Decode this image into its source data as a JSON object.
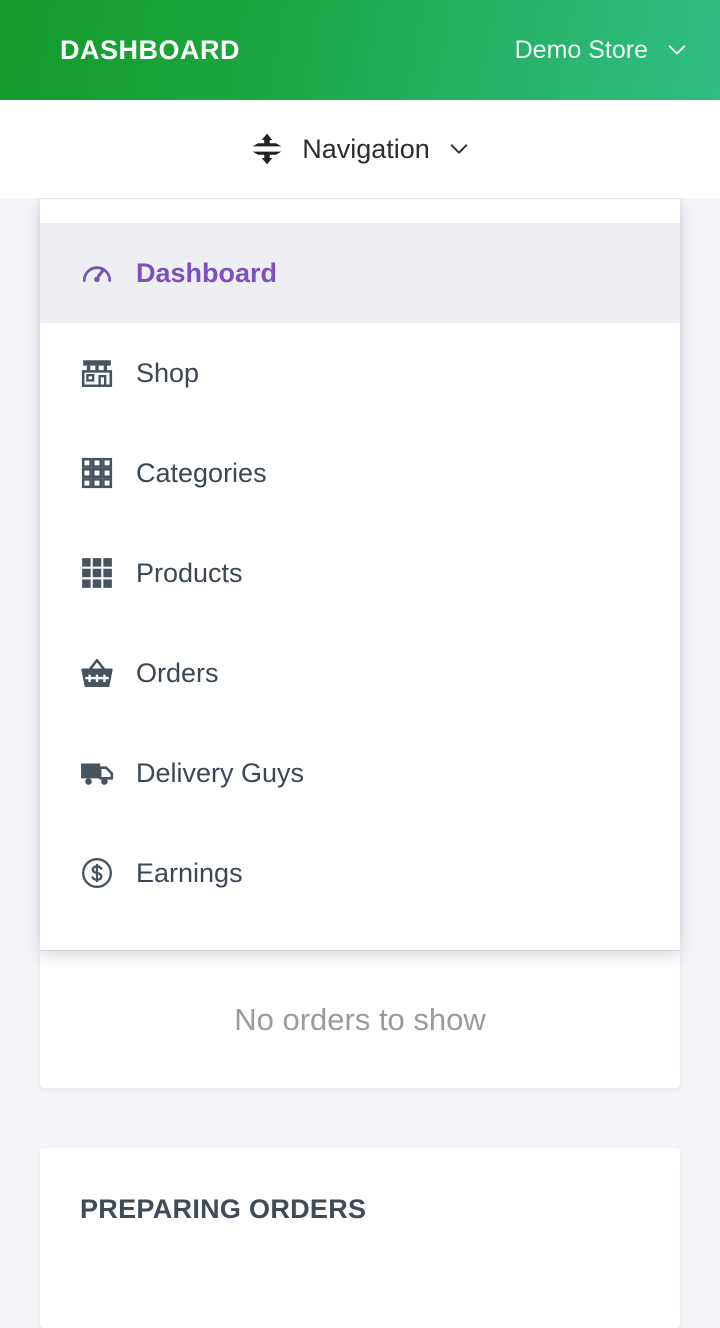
{
  "header": {
    "title": "DASHBOARD",
    "store_name": "Demo Store",
    "store_caret_icon": "chevron-down-icon",
    "gradient_from": "#159a2b",
    "gradient_to": "#2fbd84"
  },
  "nav_bar": {
    "expand_icon": "arrows-expand-vertical-icon",
    "label": "Navigation",
    "caret_icon": "chevron-down-icon"
  },
  "nav_dropdown": {
    "active_color": "#7e4fc0",
    "items": [
      {
        "label": "Dashboard",
        "icon": "tachometer-icon",
        "active": true
      },
      {
        "label": "Shop",
        "icon": "store-icon",
        "active": false
      },
      {
        "label": "Categories",
        "icon": "grid-outline-icon",
        "active": false
      },
      {
        "label": "Products",
        "icon": "grid-filled-icon",
        "active": false
      },
      {
        "label": "Orders",
        "icon": "basket-icon",
        "active": false
      },
      {
        "label": "Delivery Guys",
        "icon": "truck-icon",
        "active": false
      },
      {
        "label": "Earnings",
        "icon": "dollar-circle-icon",
        "active": false
      }
    ]
  },
  "main": {
    "empty_orders_text": "No orders to show",
    "preparing_orders_title": "PREPARING ORDERS"
  }
}
